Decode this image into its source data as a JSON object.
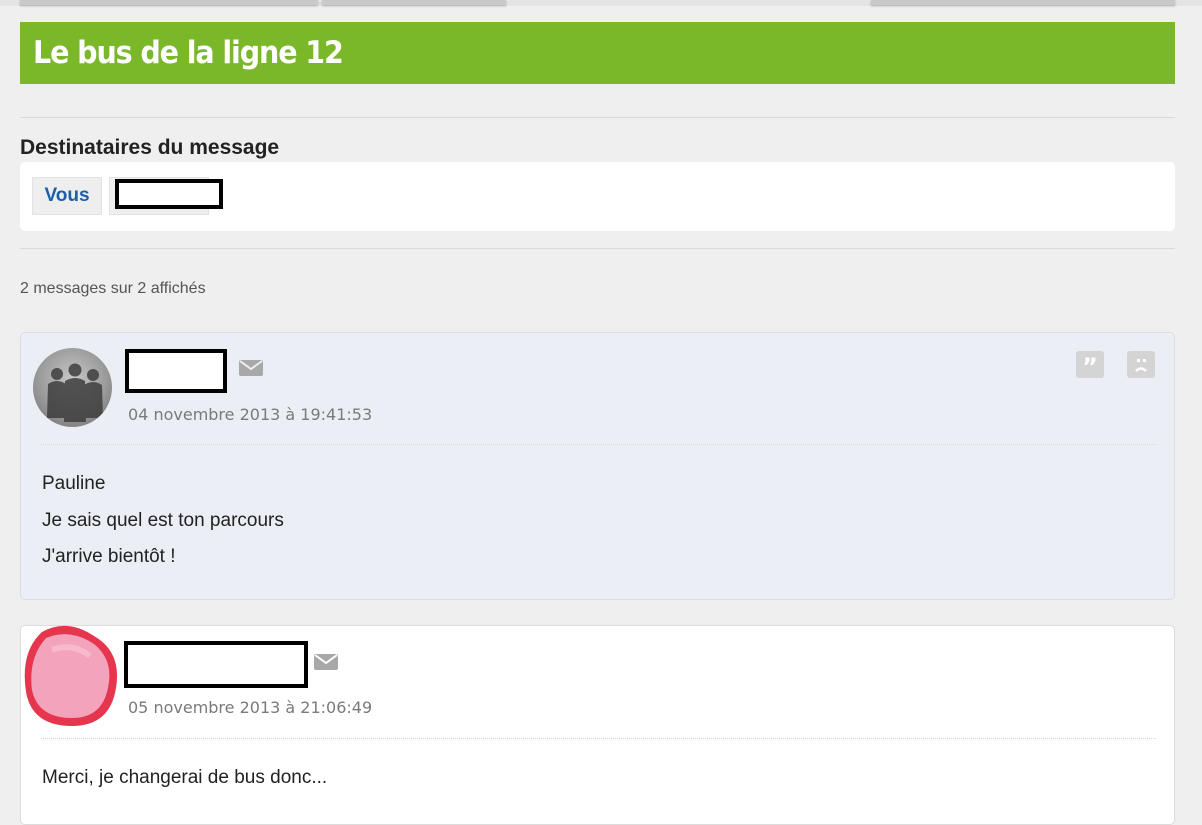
{
  "page": {
    "title": "Le bus de la ligne 12",
    "accent_color": "#7ab829"
  },
  "recipients": {
    "heading": "Destinataires du message",
    "items": [
      {
        "label": "Vous",
        "redacted": false
      },
      {
        "label": "",
        "redacted": true
      }
    ]
  },
  "messages_count": "2 messages sur 2 affichés",
  "messages": [
    {
      "author": "",
      "author_redacted": true,
      "date": "04 novembre 2013 à 19:41:53",
      "avatar": "group-silhouette-avatar",
      "lines": [
        "Pauline",
        "Je sais quel est ton parcours",
        "J'arrive bientôt !"
      ],
      "actions": [
        "quote-icon",
        "report-icon"
      ]
    },
    {
      "author": "",
      "author_redacted": true,
      "date": "05 novembre 2013 à 21:06:49",
      "avatar": "pink-scribble-avatar",
      "lines": [
        "Merci, je changerai de bus donc..."
      ]
    }
  ]
}
